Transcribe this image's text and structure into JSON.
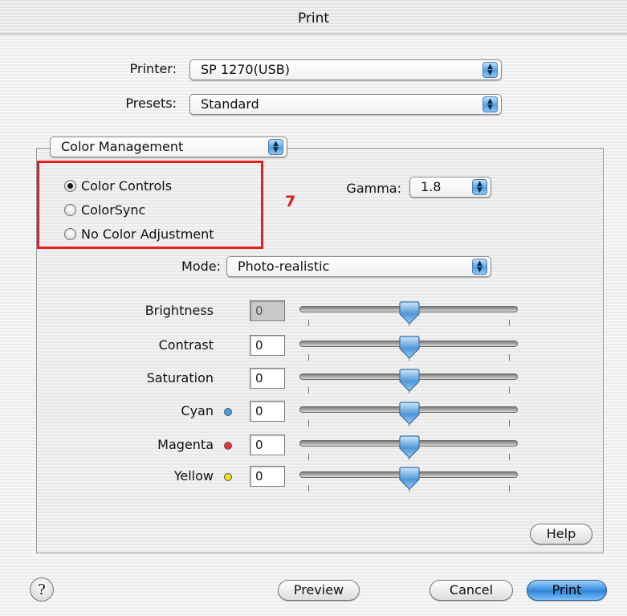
{
  "window": {
    "title": "Print"
  },
  "printer": {
    "label": "Printer:",
    "value": "SP 1270(USB)"
  },
  "presets": {
    "label": "Presets:",
    "value": "Standard"
  },
  "panel_selector": {
    "value": "Color Management"
  },
  "color_options": [
    {
      "label": "Color Controls",
      "selected": true
    },
    {
      "label": "ColorSync",
      "selected": false
    },
    {
      "label": "No Color Adjustment",
      "selected": false
    }
  ],
  "annotation": {
    "step": "7",
    "highlight_color": "#e61e1e"
  },
  "gamma": {
    "label": "Gamma:",
    "value": "1.8"
  },
  "mode": {
    "label": "Mode:",
    "value": "Photo-realistic"
  },
  "sliders": [
    {
      "label": "Brightness",
      "value": "0",
      "dot_color": null
    },
    {
      "label": "Contrast",
      "value": "0",
      "dot_color": null
    },
    {
      "label": "Saturation",
      "value": "0",
      "dot_color": null
    },
    {
      "label": "Cyan",
      "value": "0",
      "dot_color": "#3aa2ee"
    },
    {
      "label": "Magenta",
      "value": "0",
      "dot_color": "#e8323c"
    },
    {
      "label": "Yellow",
      "value": "0",
      "dot_color": "#f0e21a"
    }
  ],
  "buttons": {
    "help_panel": "Help",
    "help_round": "?",
    "preview": "Preview",
    "cancel": "Cancel",
    "print": "Print"
  },
  "icons": {
    "popup_arrows": "up-down-arrows-icon",
    "slider_thumb": "slider-thumb-icon",
    "help": "question-mark-icon"
  },
  "colors": {
    "accent_blue": "#2f86db"
  }
}
